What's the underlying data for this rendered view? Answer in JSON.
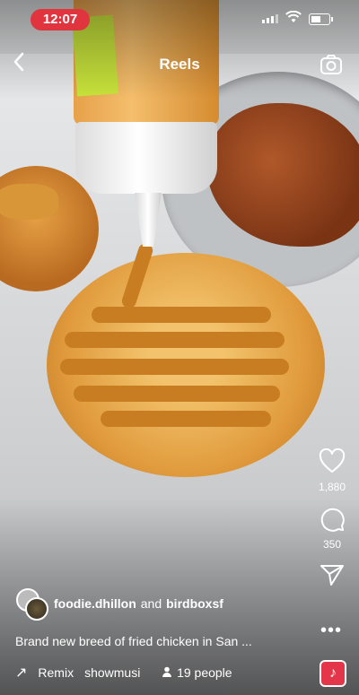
{
  "status_bar": {
    "time": "12:07"
  },
  "nav": {
    "title": "Reels"
  },
  "actions": {
    "likes": "1,880",
    "comments": "350"
  },
  "post": {
    "user1": "foodie.dhillon",
    "conjunction": "and",
    "user2": "birdboxsf",
    "caption": "Brand new breed of fried chicken in San ...",
    "remix_label": "Remix",
    "music_label": "showmusi",
    "people_count": "19 people"
  },
  "colors": {
    "time_pill": "#e0353f",
    "audio_badge": "#e4364a"
  }
}
